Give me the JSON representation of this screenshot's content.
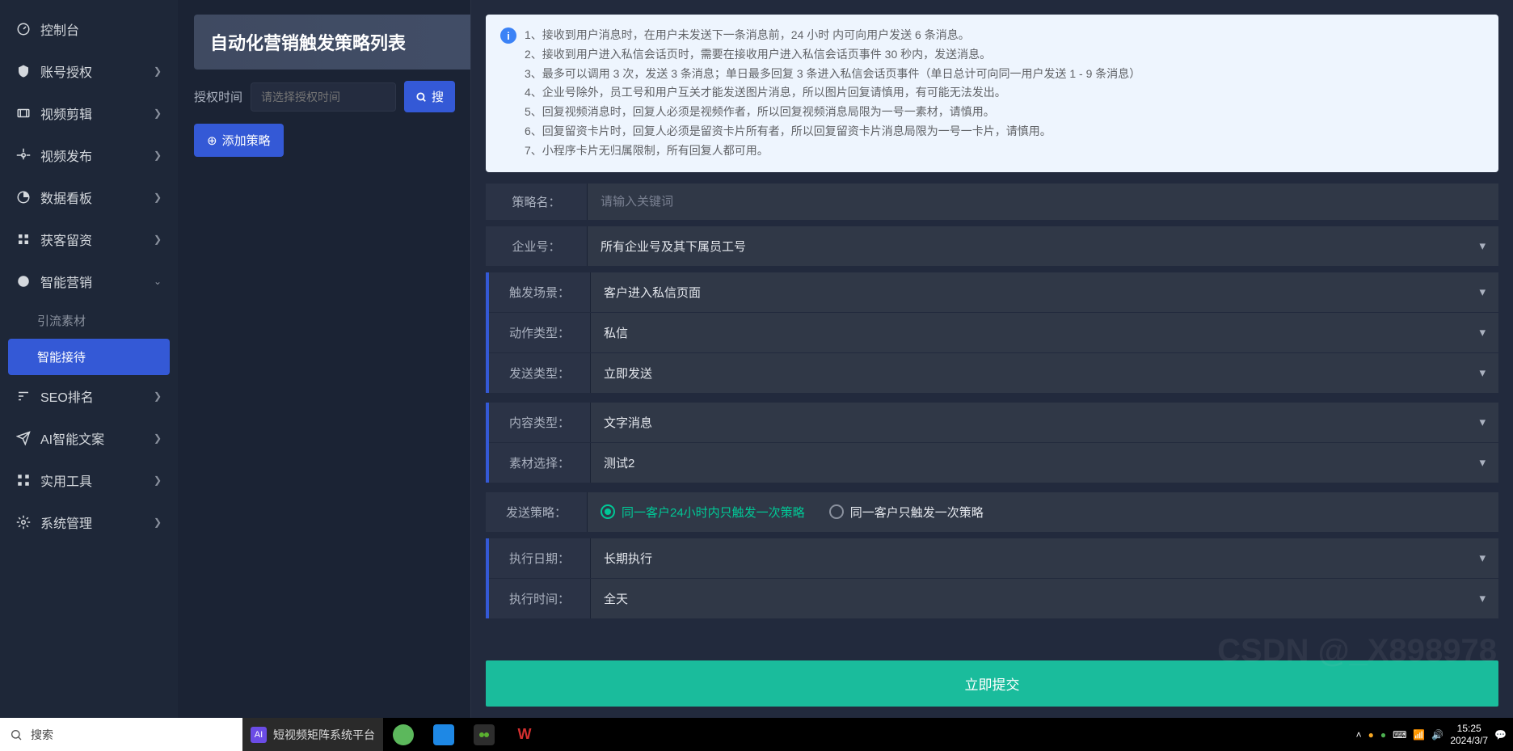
{
  "sidebar": {
    "items": [
      {
        "icon": "dashboard-icon",
        "label": "控制台",
        "hasChildren": false
      },
      {
        "icon": "auth-icon",
        "label": "账号授权",
        "hasChildren": true
      },
      {
        "icon": "video-edit-icon",
        "label": "视频剪辑",
        "hasChildren": true
      },
      {
        "icon": "video-publish-icon",
        "label": "视频发布",
        "hasChildren": true
      },
      {
        "icon": "data-board-icon",
        "label": "数据看板",
        "hasChildren": true
      },
      {
        "icon": "customer-icon",
        "label": "获客留资",
        "hasChildren": true
      },
      {
        "icon": "smart-marketing-icon",
        "label": "智能营销",
        "hasChildren": true,
        "expanded": true,
        "children": [
          {
            "label": "引流素材"
          },
          {
            "label": "智能接待",
            "active": true
          }
        ]
      },
      {
        "icon": "seo-icon",
        "label": "SEO排名",
        "hasChildren": true
      },
      {
        "icon": "ai-writing-icon",
        "label": "AI智能文案",
        "hasChildren": true
      },
      {
        "icon": "tools-icon",
        "label": "实用工具",
        "hasChildren": true
      },
      {
        "icon": "system-icon",
        "label": "系统管理",
        "hasChildren": true
      }
    ]
  },
  "page": {
    "title": "自动化营销触发策略列表",
    "filter_label": "授权时间",
    "filter_placeholder": "请选择授权时间",
    "search_btn": "搜",
    "add_btn": "添加策略"
  },
  "panel": {
    "info": [
      "接收到用户消息时，在用户未发送下一条消息前，24 小时 内可向用户发送 6 条消息。",
      "接收到用户进入私信会话页时，需要在接收用户进入私信会话页事件 30 秒内，发送消息。",
      "最多可以调用 3 次，发送 3 条消息；单日最多回复 3 条进入私信会话页事件（单日总计可向同一用户发送 1 - 9 条消息）",
      "企业号除外，员工号和用户互关才能发送图片消息，所以图片回复请慎用，有可能无法发出。",
      "回复视频消息时，回复人必须是视频作者，所以回复视频消息局限为一号一素材，请慎用。",
      "回复留资卡片时，回复人必须是留资卡片所有者，所以回复留资卡片消息局限为一号一卡片，请慎用。",
      "小程序卡片无归属限制，所有回复人都可用。"
    ],
    "fields": {
      "strategy_name": {
        "label": "策略名：",
        "placeholder": "请输入关键词"
      },
      "enterprise": {
        "label": "企业号：",
        "value": "所有企业号及其下属员工号"
      },
      "trigger_scene": {
        "label": "触发场景：",
        "value": "客户进入私信页面"
      },
      "action_type": {
        "label": "动作类型：",
        "value": "私信"
      },
      "send_type": {
        "label": "发送类型：",
        "value": "立即发送"
      },
      "content_type": {
        "label": "内容类型：",
        "value": "文字消息"
      },
      "material": {
        "label": "素材选择：",
        "value": "测试2"
      },
      "send_strategy": {
        "label": "发送策略：",
        "opt1": "同一客户24小时内只触发一次策略",
        "opt2": "同一客户只触发一次策略"
      },
      "exec_date": {
        "label": "执行日期：",
        "value": "长期执行"
      },
      "exec_time": {
        "label": "执行时间：",
        "value": "全天"
      }
    },
    "submit": "立即提交"
  },
  "taskbar": {
    "search_placeholder": "搜索",
    "app_title": "短视频矩阵系统平台",
    "watermark": "CSDN @_X898978",
    "time": "15:25",
    "date": "2024/3/7"
  }
}
